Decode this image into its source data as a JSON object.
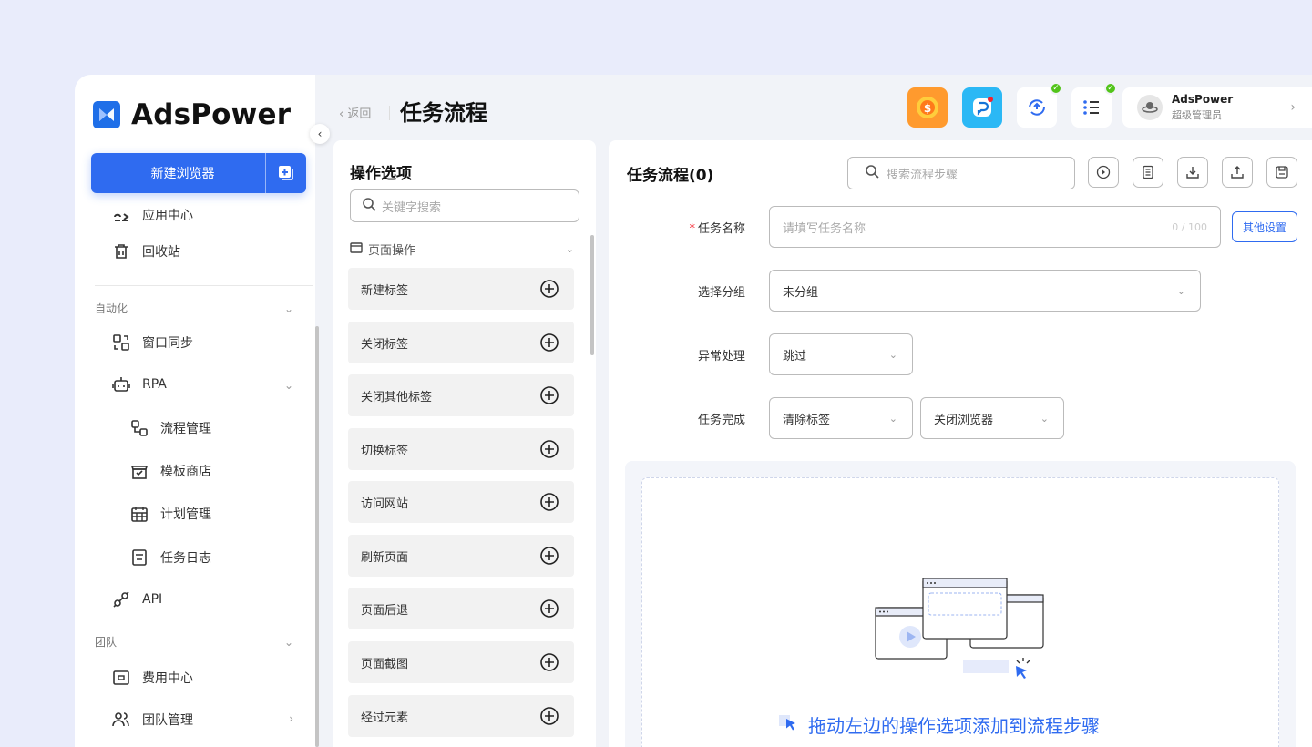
{
  "app": {
    "logo_text": "AdsPower",
    "brand_color": "#2f6bf0"
  },
  "sidebar": {
    "new_browser_label": "新建浏览器",
    "items": [
      {
        "label": "应用中心",
        "icon": "app-center-icon"
      },
      {
        "label": "回收站",
        "icon": "trash-icon"
      }
    ],
    "section_automation": "自动化",
    "automation_items": [
      {
        "label": "窗口同步",
        "icon": "window-sync-icon"
      },
      {
        "label": "RPA",
        "icon": "robot-icon"
      },
      {
        "label": "流程管理",
        "icon": "flow-icon"
      },
      {
        "label": "模板商店",
        "icon": "store-icon"
      },
      {
        "label": "计划管理",
        "icon": "calendar-icon"
      },
      {
        "label": "任务日志",
        "icon": "log-icon"
      },
      {
        "label": "API",
        "icon": "api-icon"
      }
    ],
    "section_team": "团队",
    "team_items": [
      {
        "label": "费用中心",
        "icon": "billing-icon"
      },
      {
        "label": "团队管理",
        "icon": "team-icon"
      }
    ]
  },
  "header": {
    "back_label": "返回",
    "title": "任务流程",
    "user": {
      "name": "AdsPower",
      "role": "超级管理员"
    }
  },
  "ops_panel": {
    "title": "操作选项",
    "search_placeholder": "关键字搜索",
    "group_label": "页面操作",
    "items": [
      "新建标签",
      "关闭标签",
      "关闭其他标签",
      "切换标签",
      "访问网站",
      "刷新页面",
      "页面后退",
      "页面截图",
      "经过元素"
    ]
  },
  "flow_panel": {
    "title": "任务流程(0)",
    "search_placeholder": "搜索流程步骤",
    "task_name_label": "任务名称",
    "task_name_placeholder": "请填写任务名称",
    "task_name_count": "0 / 100",
    "other_settings_label": "其他设置",
    "group_label": "选择分组",
    "group_value": "未分组",
    "exception_label": "异常处理",
    "exception_value": "跳过",
    "complete_label": "任务完成",
    "complete_value_1": "清除标签",
    "complete_value_2": "关闭浏览器",
    "drop_hint": "拖动左边的操作选项添加到流程步骤"
  }
}
